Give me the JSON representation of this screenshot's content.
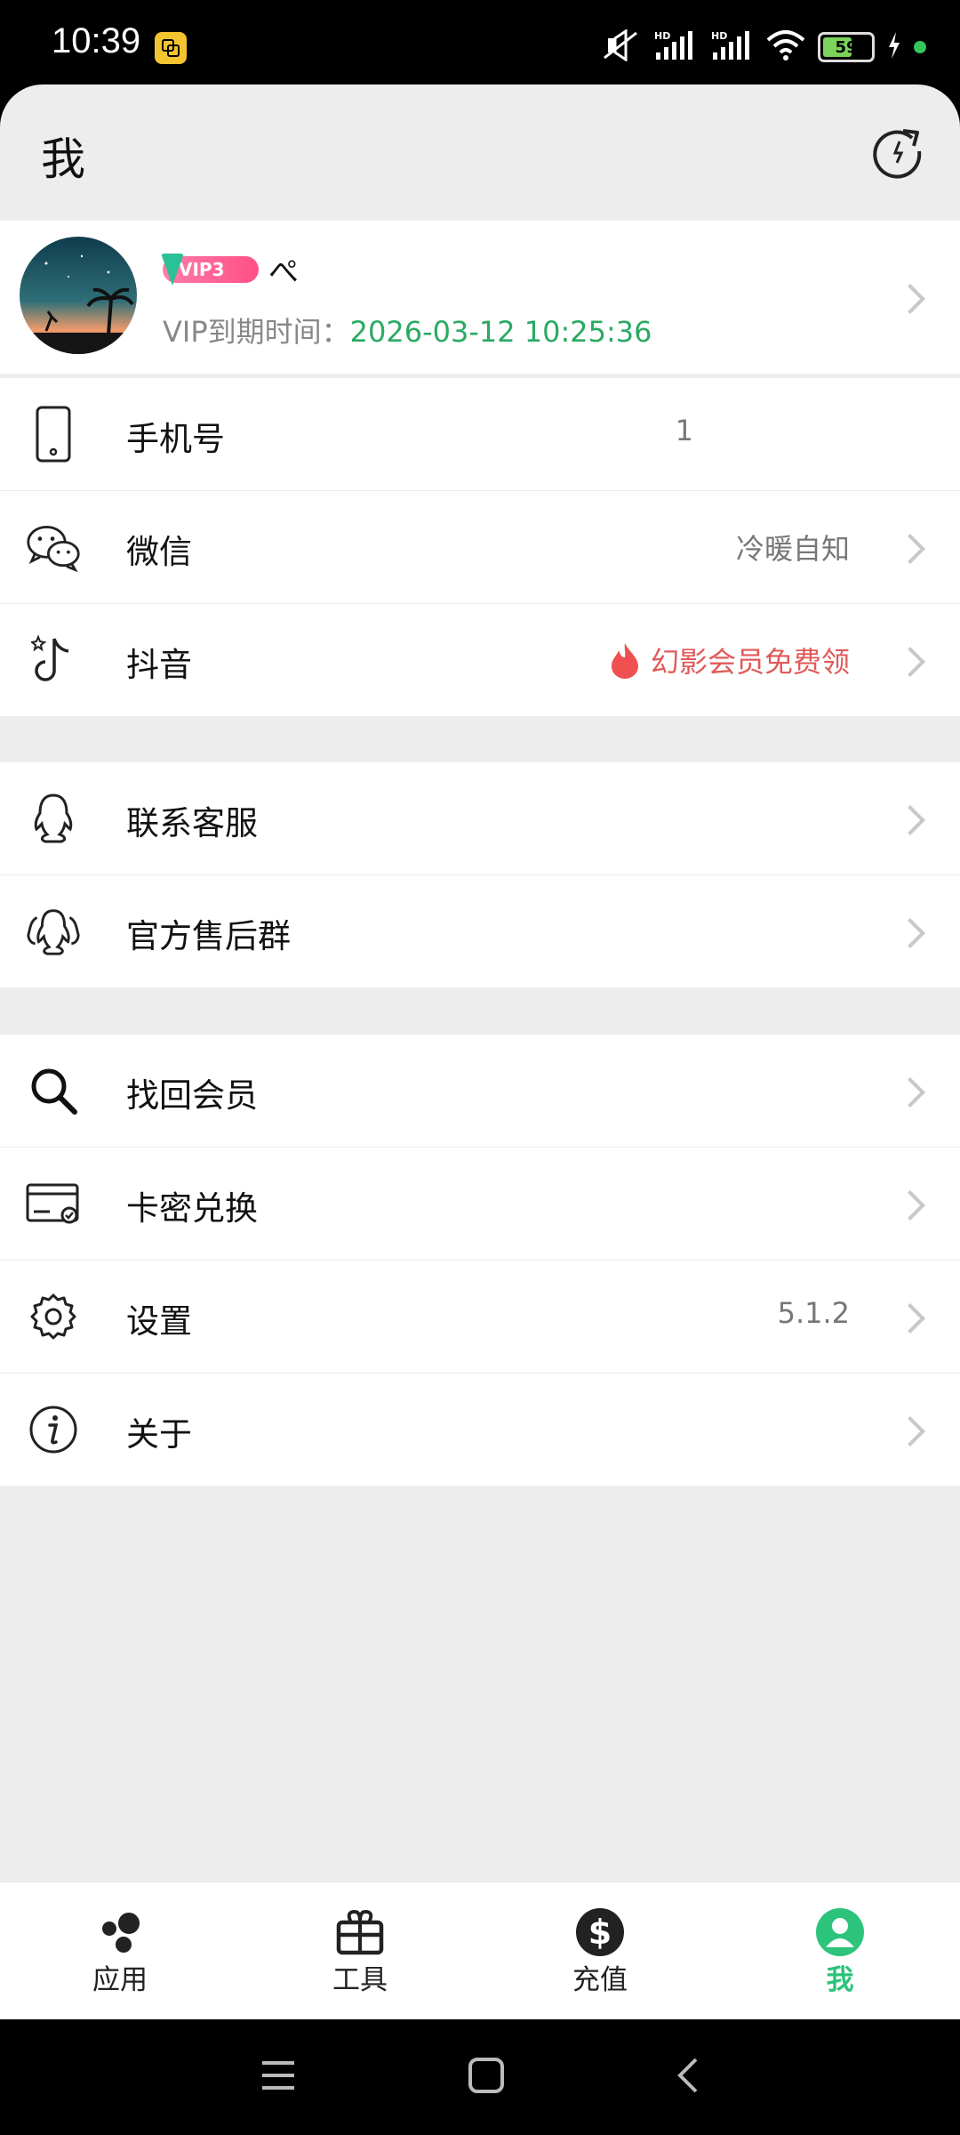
{
  "status_bar": {
    "time": "10:39",
    "battery": "59",
    "icons": [
      "app-notification-icon",
      "mute-icon",
      "signal-hd-1-icon",
      "signal-hd-2-icon",
      "wifi-icon",
      "battery-icon",
      "charging-icon",
      "active-indicator"
    ]
  },
  "header": {
    "title": "我"
  },
  "profile": {
    "vip_label": "VIP3",
    "username": "ぺ",
    "expire_label": "VIP到期时间：",
    "expire_value": "2026-03-12 10:25:36"
  },
  "group1": [
    {
      "label": "手机号",
      "value": "1",
      "icon": "phone-icon"
    },
    {
      "label": "微信",
      "value": "冷暖自知",
      "icon": "wechat-icon"
    },
    {
      "label": "抖音",
      "value": "幻影会员免费领",
      "icon": "douyin-icon"
    }
  ],
  "group2": [
    {
      "label": "联系客服",
      "icon": "qq-icon"
    },
    {
      "label": "官方售后群",
      "icon": "qq-group-icon"
    }
  ],
  "group3": [
    {
      "label": "找回会员",
      "icon": "search-icon"
    },
    {
      "label": "卡密兑换",
      "icon": "card-icon"
    },
    {
      "label": "设置",
      "value": "5.1.2",
      "icon": "gear-icon"
    },
    {
      "label": "关于",
      "icon": "info-icon"
    }
  ],
  "bottom_nav": [
    {
      "label": "应用",
      "icon": "apps-icon"
    },
    {
      "label": "工具",
      "icon": "toolbox-icon"
    },
    {
      "label": "充值",
      "icon": "dollar-icon"
    },
    {
      "label": "我",
      "icon": "profile-icon",
      "active": true
    }
  ],
  "colors": {
    "accent": "#2cc37a",
    "expire": "#2aaa63",
    "promo": "#e05a5a",
    "background": "#ededed"
  }
}
